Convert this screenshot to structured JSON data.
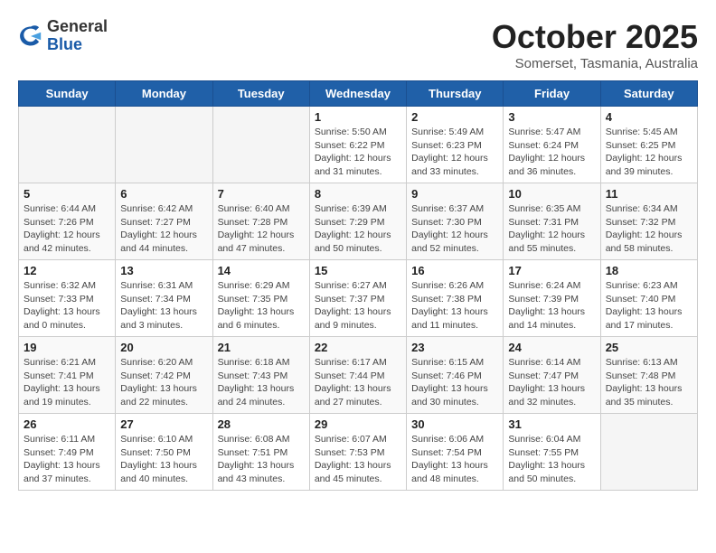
{
  "header": {
    "logo_general": "General",
    "logo_blue": "Blue",
    "month_title": "October 2025",
    "location": "Somerset, Tasmania, Australia"
  },
  "weekdays": [
    "Sunday",
    "Monday",
    "Tuesday",
    "Wednesday",
    "Thursday",
    "Friday",
    "Saturday"
  ],
  "weeks": [
    [
      {
        "day": "",
        "info": ""
      },
      {
        "day": "",
        "info": ""
      },
      {
        "day": "",
        "info": ""
      },
      {
        "day": "1",
        "info": "Sunrise: 5:50 AM\nSunset: 6:22 PM\nDaylight: 12 hours\nand 31 minutes."
      },
      {
        "day": "2",
        "info": "Sunrise: 5:49 AM\nSunset: 6:23 PM\nDaylight: 12 hours\nand 33 minutes."
      },
      {
        "day": "3",
        "info": "Sunrise: 5:47 AM\nSunset: 6:24 PM\nDaylight: 12 hours\nand 36 minutes."
      },
      {
        "day": "4",
        "info": "Sunrise: 5:45 AM\nSunset: 6:25 PM\nDaylight: 12 hours\nand 39 minutes."
      }
    ],
    [
      {
        "day": "5",
        "info": "Sunrise: 6:44 AM\nSunset: 7:26 PM\nDaylight: 12 hours\nand 42 minutes."
      },
      {
        "day": "6",
        "info": "Sunrise: 6:42 AM\nSunset: 7:27 PM\nDaylight: 12 hours\nand 44 minutes."
      },
      {
        "day": "7",
        "info": "Sunrise: 6:40 AM\nSunset: 7:28 PM\nDaylight: 12 hours\nand 47 minutes."
      },
      {
        "day": "8",
        "info": "Sunrise: 6:39 AM\nSunset: 7:29 PM\nDaylight: 12 hours\nand 50 minutes."
      },
      {
        "day": "9",
        "info": "Sunrise: 6:37 AM\nSunset: 7:30 PM\nDaylight: 12 hours\nand 52 minutes."
      },
      {
        "day": "10",
        "info": "Sunrise: 6:35 AM\nSunset: 7:31 PM\nDaylight: 12 hours\nand 55 minutes."
      },
      {
        "day": "11",
        "info": "Sunrise: 6:34 AM\nSunset: 7:32 PM\nDaylight: 12 hours\nand 58 minutes."
      }
    ],
    [
      {
        "day": "12",
        "info": "Sunrise: 6:32 AM\nSunset: 7:33 PM\nDaylight: 13 hours\nand 0 minutes."
      },
      {
        "day": "13",
        "info": "Sunrise: 6:31 AM\nSunset: 7:34 PM\nDaylight: 13 hours\nand 3 minutes."
      },
      {
        "day": "14",
        "info": "Sunrise: 6:29 AM\nSunset: 7:35 PM\nDaylight: 13 hours\nand 6 minutes."
      },
      {
        "day": "15",
        "info": "Sunrise: 6:27 AM\nSunset: 7:37 PM\nDaylight: 13 hours\nand 9 minutes."
      },
      {
        "day": "16",
        "info": "Sunrise: 6:26 AM\nSunset: 7:38 PM\nDaylight: 13 hours\nand 11 minutes."
      },
      {
        "day": "17",
        "info": "Sunrise: 6:24 AM\nSunset: 7:39 PM\nDaylight: 13 hours\nand 14 minutes."
      },
      {
        "day": "18",
        "info": "Sunrise: 6:23 AM\nSunset: 7:40 PM\nDaylight: 13 hours\nand 17 minutes."
      }
    ],
    [
      {
        "day": "19",
        "info": "Sunrise: 6:21 AM\nSunset: 7:41 PM\nDaylight: 13 hours\nand 19 minutes."
      },
      {
        "day": "20",
        "info": "Sunrise: 6:20 AM\nSunset: 7:42 PM\nDaylight: 13 hours\nand 22 minutes."
      },
      {
        "day": "21",
        "info": "Sunrise: 6:18 AM\nSunset: 7:43 PM\nDaylight: 13 hours\nand 24 minutes."
      },
      {
        "day": "22",
        "info": "Sunrise: 6:17 AM\nSunset: 7:44 PM\nDaylight: 13 hours\nand 27 minutes."
      },
      {
        "day": "23",
        "info": "Sunrise: 6:15 AM\nSunset: 7:46 PM\nDaylight: 13 hours\nand 30 minutes."
      },
      {
        "day": "24",
        "info": "Sunrise: 6:14 AM\nSunset: 7:47 PM\nDaylight: 13 hours\nand 32 minutes."
      },
      {
        "day": "25",
        "info": "Sunrise: 6:13 AM\nSunset: 7:48 PM\nDaylight: 13 hours\nand 35 minutes."
      }
    ],
    [
      {
        "day": "26",
        "info": "Sunrise: 6:11 AM\nSunset: 7:49 PM\nDaylight: 13 hours\nand 37 minutes."
      },
      {
        "day": "27",
        "info": "Sunrise: 6:10 AM\nSunset: 7:50 PM\nDaylight: 13 hours\nand 40 minutes."
      },
      {
        "day": "28",
        "info": "Sunrise: 6:08 AM\nSunset: 7:51 PM\nDaylight: 13 hours\nand 43 minutes."
      },
      {
        "day": "29",
        "info": "Sunrise: 6:07 AM\nSunset: 7:53 PM\nDaylight: 13 hours\nand 45 minutes."
      },
      {
        "day": "30",
        "info": "Sunrise: 6:06 AM\nSunset: 7:54 PM\nDaylight: 13 hours\nand 48 minutes."
      },
      {
        "day": "31",
        "info": "Sunrise: 6:04 AM\nSunset: 7:55 PM\nDaylight: 13 hours\nand 50 minutes."
      },
      {
        "day": "",
        "info": ""
      }
    ]
  ]
}
